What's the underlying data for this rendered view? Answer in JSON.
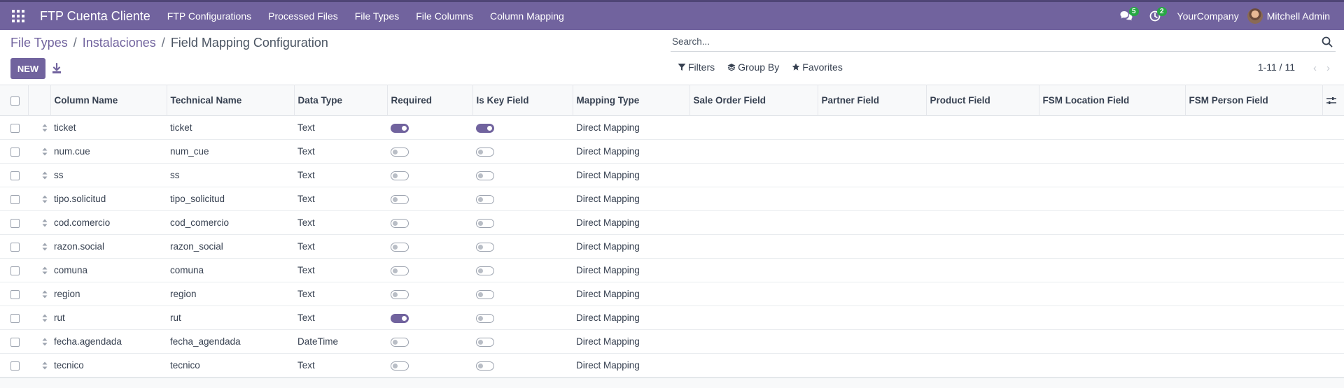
{
  "colors": {
    "brand": "#71639e",
    "badge": "#28a745"
  },
  "navbar": {
    "app_title": "FTP Cuenta Cliente",
    "menu": [
      "FTP Configurations",
      "Processed Files",
      "File Types",
      "File Columns",
      "Column Mapping"
    ],
    "messages_badge": "5",
    "activities_badge": "2",
    "company": "YourCompany",
    "user": "Mitchell Admin"
  },
  "breadcrumb": {
    "items": [
      "File Types",
      "Instalaciones"
    ],
    "current": "Field Mapping Configuration"
  },
  "toolbar": {
    "new_label": "NEW"
  },
  "search": {
    "placeholder": "Search..."
  },
  "filters": {
    "filters_label": "Filters",
    "groupby_label": "Group By",
    "favorites_label": "Favorites"
  },
  "pager": {
    "value": "1-11 / 11"
  },
  "table": {
    "columns": [
      "Column Name",
      "Technical Name",
      "Data Type",
      "Required",
      "Is Key Field",
      "Mapping Type",
      "Sale Order Field",
      "Partner Field",
      "Product Field",
      "FSM Location Field",
      "FSM Person Field"
    ],
    "rows": [
      {
        "column_name": "ticket",
        "technical_name": "ticket",
        "data_type": "Text",
        "required": true,
        "is_key": true,
        "mapping_type": "Direct Mapping"
      },
      {
        "column_name": "num.cue",
        "technical_name": "num_cue",
        "data_type": "Text",
        "required": false,
        "is_key": false,
        "mapping_type": "Direct Mapping"
      },
      {
        "column_name": "ss",
        "technical_name": "ss",
        "data_type": "Text",
        "required": false,
        "is_key": false,
        "mapping_type": "Direct Mapping"
      },
      {
        "column_name": "tipo.solicitud",
        "technical_name": "tipo_solicitud",
        "data_type": "Text",
        "required": false,
        "is_key": false,
        "mapping_type": "Direct Mapping"
      },
      {
        "column_name": "cod.comercio",
        "technical_name": "cod_comercio",
        "data_type": "Text",
        "required": false,
        "is_key": false,
        "mapping_type": "Direct Mapping"
      },
      {
        "column_name": "razon.social",
        "technical_name": "razon_social",
        "data_type": "Text",
        "required": false,
        "is_key": false,
        "mapping_type": "Direct Mapping"
      },
      {
        "column_name": "comuna",
        "technical_name": "comuna",
        "data_type": "Text",
        "required": false,
        "is_key": false,
        "mapping_type": "Direct Mapping"
      },
      {
        "column_name": "region",
        "technical_name": "region",
        "data_type": "Text",
        "required": false,
        "is_key": false,
        "mapping_type": "Direct Mapping"
      },
      {
        "column_name": "rut",
        "technical_name": "rut",
        "data_type": "Text",
        "required": true,
        "is_key": false,
        "mapping_type": "Direct Mapping"
      },
      {
        "column_name": "fecha.agendada",
        "technical_name": "fecha_agendada",
        "data_type": "DateTime",
        "required": false,
        "is_key": false,
        "mapping_type": "Direct Mapping"
      },
      {
        "column_name": "tecnico",
        "technical_name": "tecnico",
        "data_type": "Text",
        "required": false,
        "is_key": false,
        "mapping_type": "Direct Mapping"
      }
    ]
  }
}
